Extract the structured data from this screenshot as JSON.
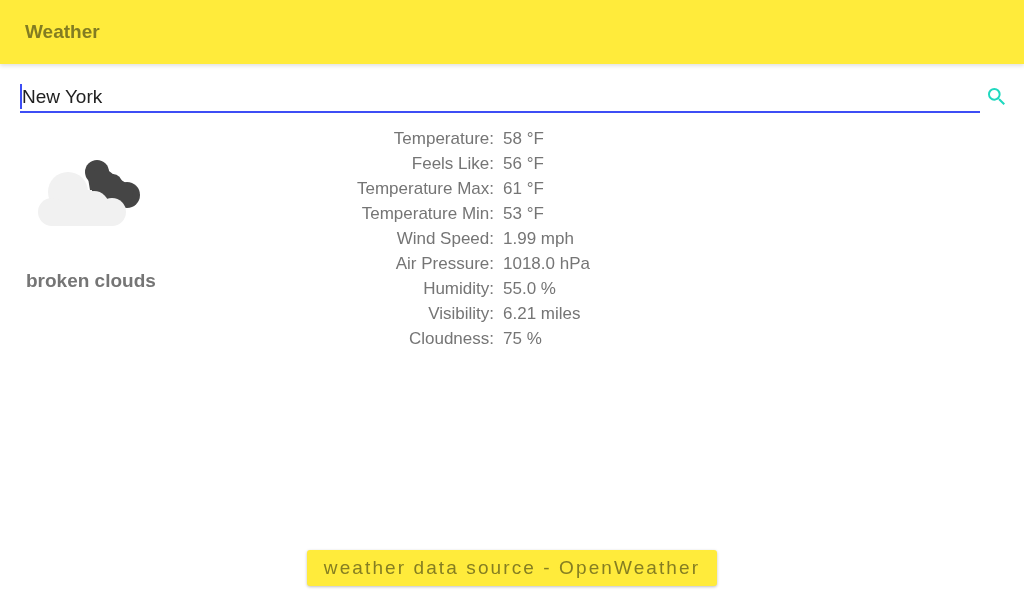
{
  "app_bar": {
    "title": "Weather"
  },
  "search": {
    "value": "New York",
    "focused": true
  },
  "current": {
    "description": "broken clouds"
  },
  "details": [
    {
      "label": "Temperature:",
      "value": "58 °F"
    },
    {
      "label": "Feels Like:",
      "value": "56 °F"
    },
    {
      "label": "Temperature Max:",
      "value": "61 °F"
    },
    {
      "label": "Temperature Min:",
      "value": "53 °F"
    },
    {
      "label": "Wind Speed:",
      "value": "1.99 mph"
    },
    {
      "label": "Air Pressure:",
      "value": "1018.0 hPa"
    },
    {
      "label": "Humidity:",
      "value": "55.0 %"
    },
    {
      "label": "Visibility:",
      "value": "6.21 miles"
    },
    {
      "label": "Cloudness:",
      "value": "75 %"
    }
  ],
  "source_button": {
    "label": "weather data source - OpenWeather"
  }
}
